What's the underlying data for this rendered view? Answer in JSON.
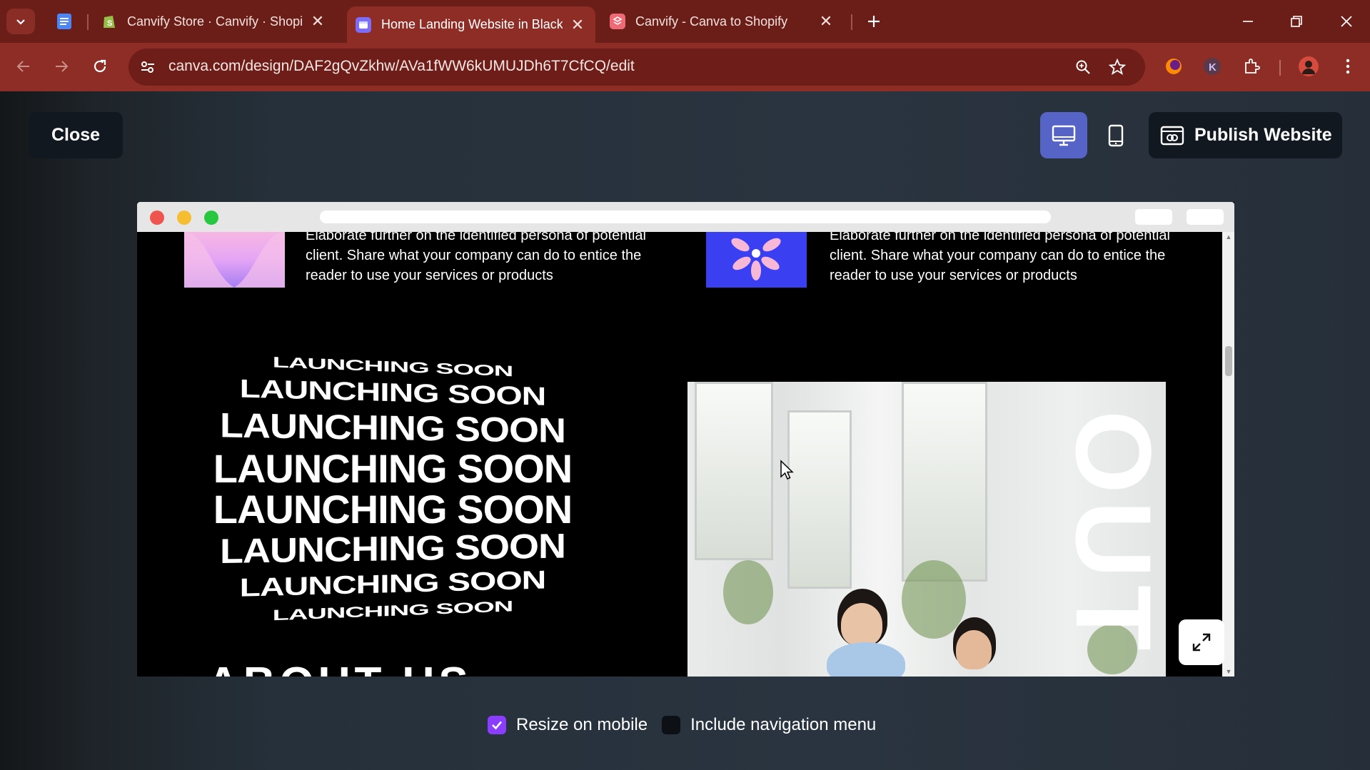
{
  "browser": {
    "tabs": [
      {
        "title": "Canvify Store · Canvify · Shopify",
        "favicon": "shopify-icon",
        "active": false
      },
      {
        "title": "Home Landing Website in Black",
        "favicon": "canva-icon",
        "active": true
      },
      {
        "title": "Canvify - Canva to Shopify",
        "favicon": "canvify-icon",
        "active": false
      }
    ],
    "url": "canva.com/design/DAF2gQvZkhw/AVa1fWW6kUMUJDh6T7CfCQ/edit",
    "colors": {
      "frame": "#6b1d18",
      "toolbar": "#8d2d26"
    }
  },
  "preview": {
    "close_label": "Close",
    "publish_label": "Publish Website",
    "active_view": "desktop",
    "options": {
      "resize_on_mobile": {
        "label": "Resize on mobile",
        "checked": true
      },
      "include_navigation": {
        "label": "Include navigation menu",
        "checked": false
      }
    },
    "accent": "#8b3dff"
  },
  "site": {
    "cards": [
      {
        "text": "Elaborate further on the identified persona of potential client. Share what your company can do to entice the reader to use your services or products"
      },
      {
        "text": "Elaborate further on the identified persona of potential client. Share what your company can do to entice the reader to use your services or products"
      }
    ],
    "launch_text": "LAUNCHING SOON",
    "about_heading": "ABOUT US",
    "photo_word": "OUT"
  }
}
